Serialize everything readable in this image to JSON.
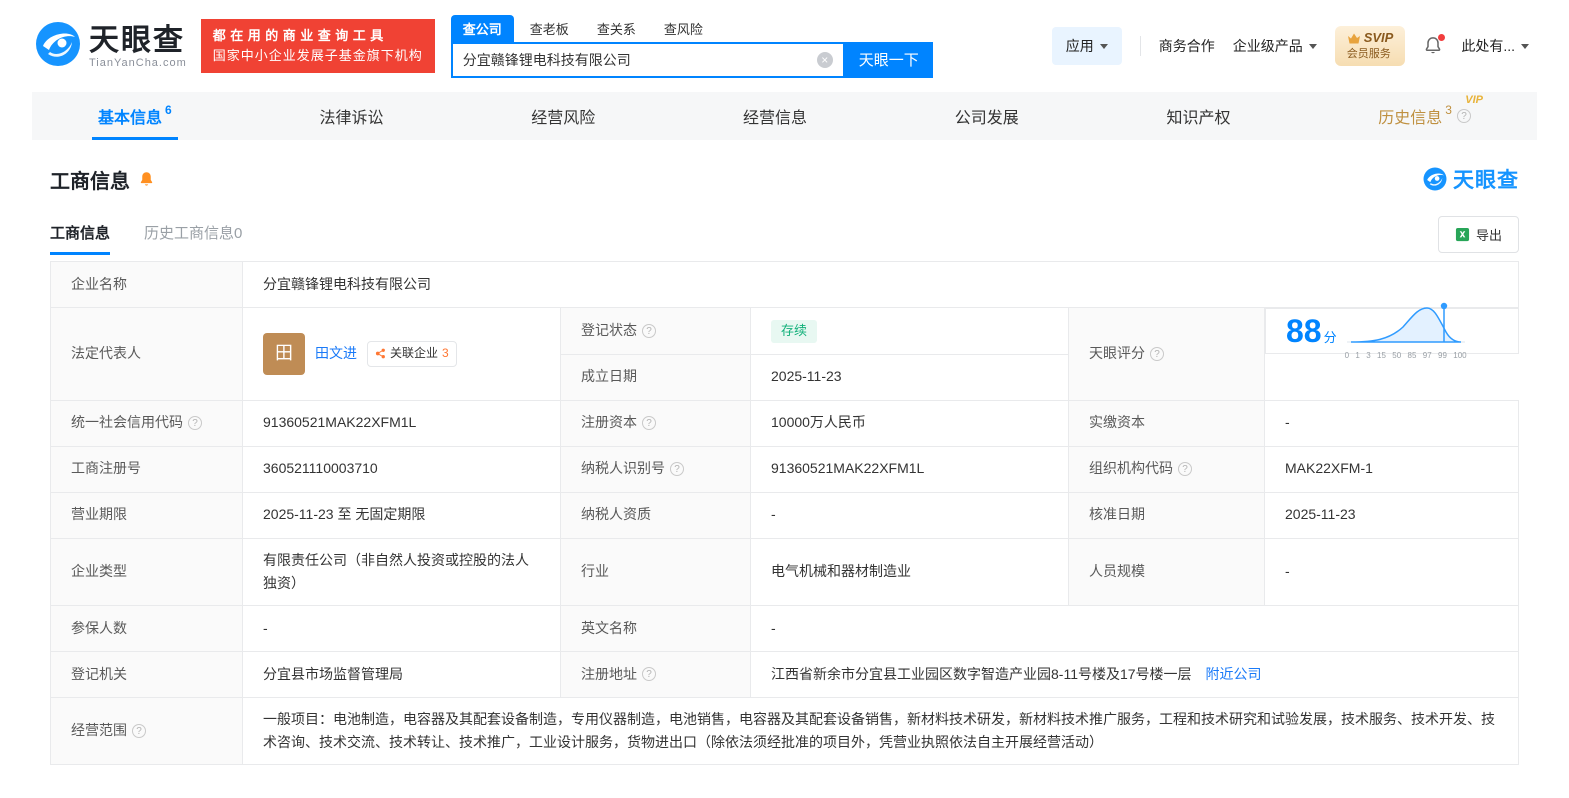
{
  "colors": {
    "brand_blue": "#0084ff",
    "promo_red": "#f04234",
    "link_blue": "#1a7af8",
    "status_green": "#12b07a",
    "vip_gold": "#e8b339",
    "avatar_brown": "#bf8c55"
  },
  "header": {
    "brand": {
      "name": "天眼查",
      "domain": "TianYanCha.com"
    },
    "promo": {
      "line1": "都在用的商业查询工具",
      "line2": "国家中小企业发展子基金旗下机构"
    },
    "search_tabs": [
      {
        "label": "查公司"
      },
      {
        "label": "查老板"
      },
      {
        "label": "查关系"
      },
      {
        "label": "查风险"
      }
    ],
    "search": {
      "value": "分宜赣锋锂电科技有限公司",
      "button_label": "天眼一下"
    },
    "nav": {
      "app": "应用",
      "cooperation": "商务合作",
      "enterprise": "企业级产品",
      "svip_line1": "SVIP",
      "svip_line2": "会员服务",
      "user": "此处有..."
    }
  },
  "nav_tabs": [
    {
      "label": "基本信息",
      "count": "6"
    },
    {
      "label": "法律诉讼"
    },
    {
      "label": "经营风险"
    },
    {
      "label": "经营信息"
    },
    {
      "label": "公司发展"
    },
    {
      "label": "知识产权"
    },
    {
      "label": "历史信息",
      "count": "3",
      "vip": "VIP"
    }
  ],
  "section": {
    "title": "工商信息",
    "brand_mark": "天眼查",
    "subtab_active": "工商信息",
    "subtab_history": "历史工商信息0",
    "export_label": "导出"
  },
  "info": {
    "company_name": {
      "label": "企业名称",
      "value": "分宜赣锋锂电科技有限公司"
    },
    "legal_rep": {
      "label": "法定代表人",
      "avatar": "田",
      "name": "田文进",
      "related_label": "关联企业",
      "related_count": "3"
    },
    "reg_status": {
      "label": "登记状态",
      "value": "存续"
    },
    "establish_date": {
      "label": "成立日期",
      "value": "2025-11-23"
    },
    "score": {
      "label": "天眼评分",
      "value": "88",
      "unit": "分"
    },
    "score_axis": [
      "0",
      "1",
      "3",
      "15",
      "50",
      "85",
      "97",
      "99",
      "100"
    ],
    "credit_code": {
      "label": "统一社会信用代码",
      "value": "91360521MAK22XFM1L"
    },
    "reg_capital": {
      "label": "注册资本",
      "value": "10000万人民币"
    },
    "paid_capital": {
      "label": "实缴资本",
      "value": "-"
    },
    "reg_number": {
      "label": "工商注册号",
      "value": "360521110003710"
    },
    "taxpayer_id": {
      "label": "纳税人识别号",
      "value": "91360521MAK22XFM1L"
    },
    "org_code": {
      "label": "组织机构代码",
      "value": "MAK22XFM-1"
    },
    "business_term": {
      "label": "营业期限",
      "value": "2025-11-23 至 无固定期限"
    },
    "taxpayer_quality": {
      "label": "纳税人资质",
      "value": "-"
    },
    "approval_date": {
      "label": "核准日期",
      "value": "2025-11-23"
    },
    "company_type": {
      "label": "企业类型",
      "value": "有限责任公司（非自然人投资或控股的法人独资）"
    },
    "industry": {
      "label": "行业",
      "value": "电气机械和器材制造业"
    },
    "staff_size": {
      "label": "人员规模",
      "value": "-"
    },
    "insured_count": {
      "label": "参保人数",
      "value": "-"
    },
    "english_name": {
      "label": "英文名称",
      "value": "-"
    },
    "reg_authority": {
      "label": "登记机关",
      "value": "分宜县市场监督管理局"
    },
    "reg_address": {
      "label": "注册地址",
      "value": "江西省新余市分宜县工业园区数字智造产业园8-11号楼及17号楼一层",
      "link": "附近公司"
    },
    "business_scope": {
      "label": "经营范围",
      "value": "一般项目：电池制造，电容器及其配套设备制造，专用仪器制造，电池销售，电容器及其配套设备销售，新材料技术研发，新材料技术推广服务，工程和技术研究和试验发展，技术服务、技术开发、技术咨询、技术交流、技术转让、技术推广，工业设计服务，货物进出口（除依法须经批准的项目外，凭营业执照依法自主开展经营活动）"
    }
  }
}
